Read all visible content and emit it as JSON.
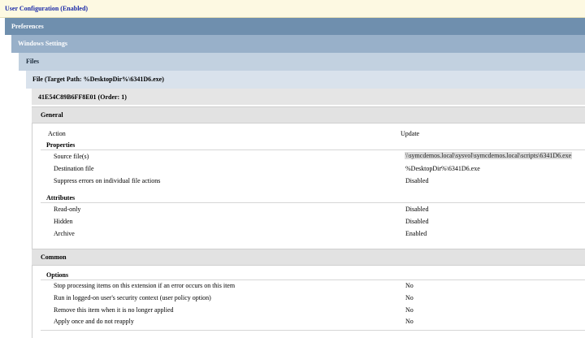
{
  "header": {
    "user_config": "User Configuration (Enabled)",
    "preferences": "Preferences",
    "windows_settings": "Windows Settings",
    "files": "Files",
    "file_item": "File (Target Path: %DesktopDir%\\6341D6.exe)",
    "item_id": "41E54C89B6FF8E01 (Order: 1)"
  },
  "general": {
    "title": "General",
    "action_label": "Action",
    "action_value": "Update",
    "properties": {
      "title": "Properties",
      "rows": [
        {
          "label": "Source file(s)",
          "value": "\\\\symcdemos.local\\sysvol\\symcdemos.local\\scripts\\6341D6.exe"
        },
        {
          "label": "Destination file",
          "value": "%DesktopDir%\\6341D6.exe"
        },
        {
          "label": "Suppress errors on individual file actions",
          "value": "Disabled"
        }
      ]
    },
    "attributes": {
      "title": "Attributes",
      "rows": [
        {
          "label": "Read-only",
          "value": "Disabled"
        },
        {
          "label": "Hidden",
          "value": "Disabled"
        },
        {
          "label": "Archive",
          "value": "Enabled"
        }
      ]
    }
  },
  "common": {
    "title": "Common",
    "options": {
      "title": "Options",
      "rows": [
        {
          "label": "Stop processing items on this extension if an error occurs on this item",
          "value": "No"
        },
        {
          "label": "Run in logged-on user's security context (user policy option)",
          "value": "No"
        },
        {
          "label": "Remove this item when it is no longer applied",
          "value": "No"
        },
        {
          "label": "Apply once and do not reapply",
          "value": "No"
        }
      ]
    }
  }
}
